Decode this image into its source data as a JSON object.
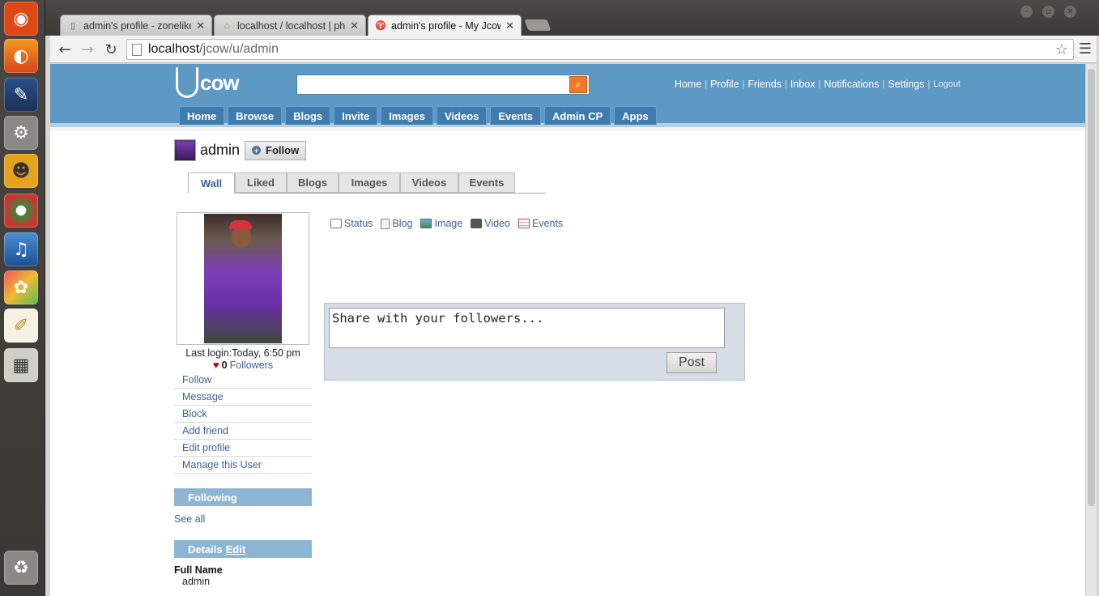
{
  "browser": {
    "tabs": [
      {
        "title": "admin's profile - zonelike",
        "favicon": "page-icon"
      },
      {
        "title": "localhost / localhost | ph",
        "favicon": "pma-icon"
      },
      {
        "title": "admin's profile - My Jcow",
        "favicon": "jcow-icon"
      }
    ],
    "url_host": "localhost",
    "url_path": "/jcow/u/admin"
  },
  "site": {
    "logo_text": "cow",
    "search_placeholder": "",
    "top_links": [
      "Home",
      "Profile",
      "Friends",
      "Inbox",
      "Notifications",
      "Settings"
    ],
    "logout": "Logout",
    "main_nav": [
      "Home",
      "Browse",
      "Blogs",
      "Invite",
      "Images",
      "Videos",
      "Events",
      "Admin CP",
      "Apps"
    ]
  },
  "profile": {
    "name": "admin",
    "follow_label": "Follow",
    "tabs": [
      "Wall",
      "Liked",
      "Blogs",
      "Images",
      "Videos",
      "Events"
    ],
    "active_tab": "Wall",
    "last_login": "Last login:Today, 6:50 pm",
    "followers_count": "0",
    "followers_label": "Followers",
    "actions": [
      "Follow",
      "Message",
      "Block",
      "Add friend",
      "Edit profile",
      "Manage this User"
    ],
    "following_title": "Following",
    "see_all": "See all",
    "details_title": "Details",
    "details_edit": "Edit",
    "full_name_label": "Full Name",
    "full_name_value": "admin"
  },
  "composer": {
    "tabs": [
      "Status",
      "Blog",
      "Image",
      "Video",
      "Events"
    ],
    "placeholder": "Share with your followers...",
    "post_label": "Post"
  },
  "colors": {
    "header": "#5e98c5",
    "nav_button": "#3f7bad",
    "link": "#3d5f9a",
    "search_button": "#f07a2a"
  }
}
